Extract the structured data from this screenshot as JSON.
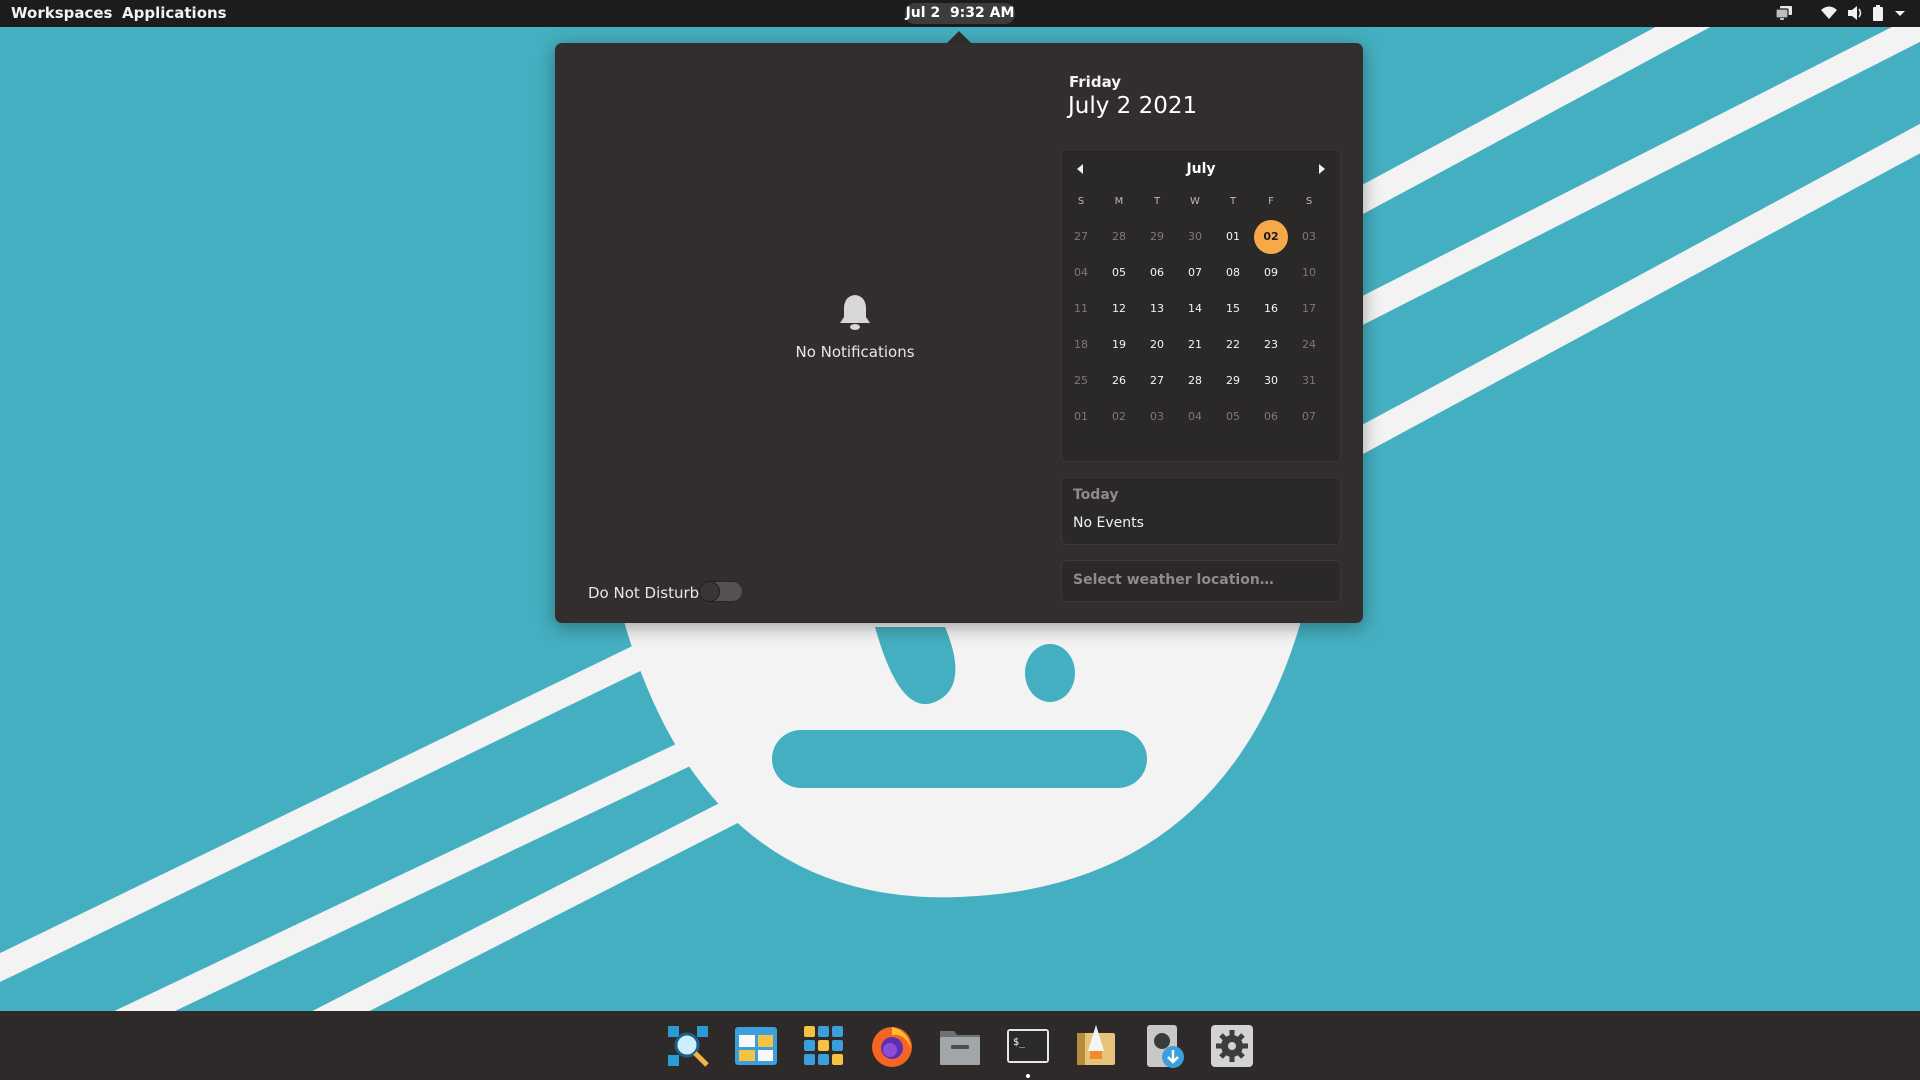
{
  "topbar": {
    "workspaces": "Workspaces",
    "applications": "Applications",
    "clock_date": "Jul 2",
    "clock_time": "9:32 AM",
    "indicators": [
      "display-icon",
      "wifi-icon",
      "volume-icon",
      "battery-icon",
      "chevron-down-icon"
    ]
  },
  "notifications": {
    "empty_text": "No Notifications",
    "dnd_label": "Do Not Disturb",
    "dnd_enabled": false
  },
  "date": {
    "weekday": "Friday",
    "full": "July 2 2021"
  },
  "calendar": {
    "month": "July",
    "weekdays": [
      "S",
      "M",
      "T",
      "W",
      "T",
      "F",
      "S"
    ],
    "weeks": [
      [
        "27",
        "28",
        "29",
        "30",
        "01",
        "02",
        "03"
      ],
      [
        "04",
        "05",
        "06",
        "07",
        "08",
        "09",
        "10"
      ],
      [
        "11",
        "12",
        "13",
        "14",
        "15",
        "16",
        "17"
      ],
      [
        "18",
        "19",
        "20",
        "21",
        "22",
        "23",
        "24"
      ],
      [
        "25",
        "26",
        "27",
        "28",
        "29",
        "30",
        "31"
      ],
      [
        "01",
        "02",
        "03",
        "04",
        "05",
        "06",
        "07"
      ]
    ],
    "selected": "02",
    "accent": "#f7a94a"
  },
  "events": {
    "title": "Today",
    "empty_text": "No Events"
  },
  "weather": {
    "placeholder": "Select weather location…"
  },
  "dock": {
    "apps": [
      "appcenter-search-icon",
      "multitasking-view-icon",
      "applications-grid-icon",
      "firefox-icon",
      "files-icon",
      "terminal-icon",
      "code-editor-icon",
      "installer-icon",
      "system-settings-icon"
    ],
    "running": "terminal-icon"
  },
  "colors": {
    "wallpaper": "#44afc0",
    "panel": "#322e2e",
    "bar": "#1d1b1b"
  }
}
